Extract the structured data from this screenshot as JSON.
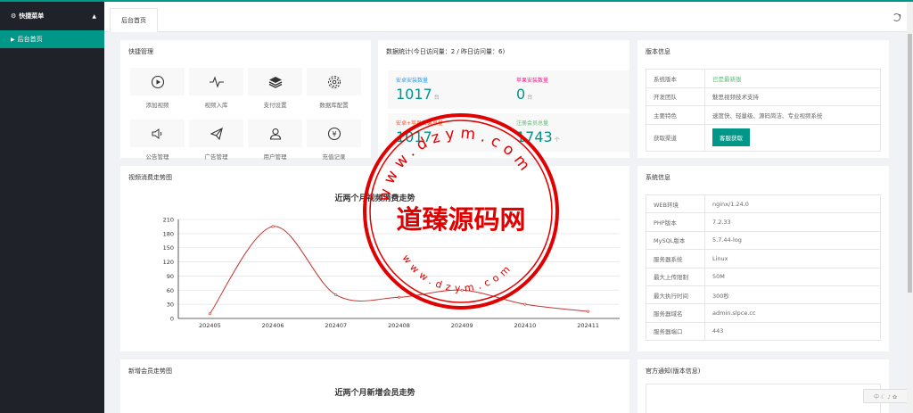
{
  "sidebar": {
    "menu_title": "快捷菜单",
    "items": [
      {
        "label": "后台首页"
      }
    ]
  },
  "tabs": [
    {
      "label": "后台首页"
    }
  ],
  "quick": {
    "title": "快捷管理",
    "items": [
      {
        "label": "添加视频",
        "icon": "play-icon"
      },
      {
        "label": "视频入库",
        "icon": "pulse-icon"
      },
      {
        "label": "支付设置",
        "icon": "layers-icon"
      },
      {
        "label": "数据库配置",
        "icon": "gear-icon"
      },
      {
        "label": "公告管理",
        "icon": "speaker-icon"
      },
      {
        "label": "广告管理",
        "icon": "paper-plane-icon"
      },
      {
        "label": "用户管理",
        "icon": "user-icon"
      },
      {
        "label": "充值记录",
        "icon": "yen-icon"
      }
    ]
  },
  "stats": {
    "title": "数据统计(今日访问量：2 / 昨日访问量：6)",
    "android": {
      "label": "安卓安装数量",
      "value": "1017",
      "unit": "台",
      "color": "#1e9fff"
    },
    "apple": {
      "label": "苹果安装数量",
      "value": "0",
      "unit": "台",
      "color": "#e91e8c"
    },
    "total": {
      "label": "安卓+苹果安装总量",
      "value": "1017",
      "unit": "台",
      "color": "#ff5722"
    },
    "members": {
      "label": "注册会员总量",
      "value": "1743",
      "unit": "个",
      "color": "#5fb878"
    }
  },
  "version": {
    "title": "版本信息",
    "rows": [
      {
        "key": "系统版本",
        "value": "已是最新版"
      },
      {
        "key": "开发团队",
        "value": "魅思视频技术支持"
      },
      {
        "key": "主要特色",
        "value": "速度快、轻量级、源码简洁、专业视频系统"
      },
      {
        "key": "获取渠道",
        "value": "客服获取"
      }
    ]
  },
  "sysinfo": {
    "title": "系统信息",
    "rows": [
      {
        "key": "WEB环境",
        "value": "nginx/1.24.0"
      },
      {
        "key": "PHP版本",
        "value": "7.2.33"
      },
      {
        "key": "MySQL版本",
        "value": "5.7.44-log"
      },
      {
        "key": "服务器系统",
        "value": "Linux"
      },
      {
        "key": "最大上传限制",
        "value": "50M"
      },
      {
        "key": "最大执行时间",
        "value": "300秒"
      },
      {
        "key": "服务器域名",
        "value": "admin.slpce.cc"
      },
      {
        "key": "服务器端口",
        "value": "443"
      }
    ]
  },
  "video_panel": {
    "title": "视频消费走势图"
  },
  "member_panel": {
    "title": "新增会员走势图",
    "chart_title": "近两个月新增会员走势"
  },
  "notice_panel": {
    "title": "官方通知(版本信息)"
  },
  "chart_data": {
    "type": "line",
    "title": "近两个月视频消费走势",
    "categories": [
      "202405",
      "202406",
      "202407",
      "202408",
      "202409",
      "202410",
      "202411"
    ],
    "values": [
      10,
      195,
      50,
      45,
      60,
      30,
      15
    ],
    "yticks": [
      0,
      30,
      60,
      90,
      120,
      150,
      180,
      210
    ],
    "ylim": [
      0,
      210
    ],
    "color": "#c23531",
    "smooth": true,
    "grid": true
  },
  "watermark": {
    "text": "道臻源码网",
    "ring_top": "www.dzym.com",
    "ring_bottom": "www.dzym.com",
    "color": "#e00000"
  },
  "badge": {
    "text": "中 ☾ ♪ ✿"
  }
}
